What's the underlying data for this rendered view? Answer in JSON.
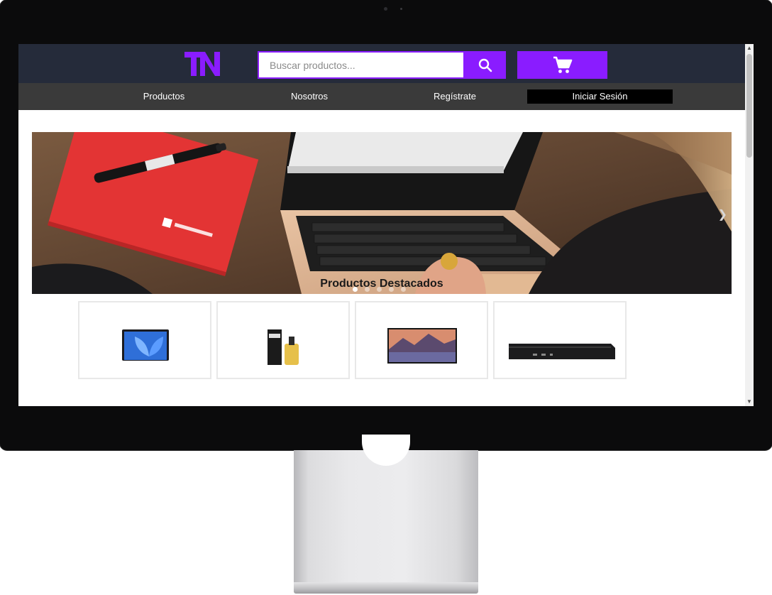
{
  "header": {
    "logo_text": "TN",
    "search_placeholder": "Buscar productos...",
    "search_icon": "search-icon",
    "cart_icon": "cart-icon"
  },
  "nav": {
    "items": [
      {
        "label": "Productos"
      },
      {
        "label": "Nosotros"
      },
      {
        "label": "Regístrate"
      },
      {
        "label": "Iniciar Sesión"
      }
    ]
  },
  "carousel": {
    "slide_count": 5,
    "active_index": 0,
    "next_icon": "chevron-right-icon"
  },
  "featured": {
    "title": "Productos Destacados",
    "products": [
      {
        "image": "laptop-image"
      },
      {
        "image": "ink-bottle-image"
      },
      {
        "image": "monitor-landscape-image"
      },
      {
        "image": "mini-pc-image"
      }
    ]
  },
  "colors": {
    "accent": "#8a1cff",
    "topbar": "#252b3a",
    "navbar": "#3a3a3a"
  }
}
